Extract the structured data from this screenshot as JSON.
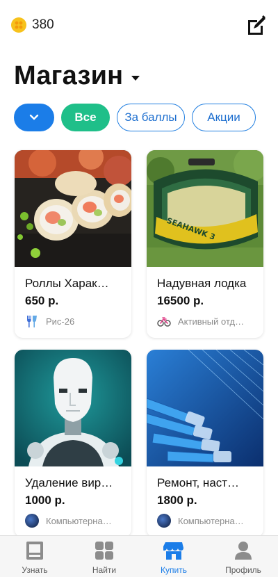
{
  "header": {
    "coins": "380",
    "coin_icon": "coin-icon",
    "edit_icon": "edit-icon"
  },
  "page": {
    "title": "Магазин",
    "title_caret_icon": "caret-down-icon"
  },
  "filters": {
    "filter_icon": "chevron-down-icon",
    "chips": [
      {
        "label": "Все",
        "active": true
      },
      {
        "label": "За баллы",
        "active": false
      },
      {
        "label": "Акции",
        "active": false
      }
    ]
  },
  "products": [
    {
      "title": "Роллы Харак…",
      "price": "650 р.",
      "vendor": "Рис-26",
      "vendor_icon": "restaurant-icon"
    },
    {
      "title": "Надувная лодка",
      "price": "16500 р.",
      "vendor": "Активный отд…",
      "vendor_icon": "bicycle-icon"
    },
    {
      "title": "Удаление вир…",
      "price": "1000 р.",
      "vendor": "Компьютерна…",
      "vendor_icon": "avatar"
    },
    {
      "title": "Ремонт, наст…",
      "price": "1800 р.",
      "vendor": "Компьютерна…",
      "vendor_icon": "avatar"
    }
  ],
  "tabbar": {
    "tabs": [
      {
        "label": "Узнать",
        "icon": "news-icon",
        "active": false
      },
      {
        "label": "Найти",
        "icon": "grid-icon",
        "active": false
      },
      {
        "label": "Купить",
        "icon": "store-icon",
        "active": true
      },
      {
        "label": "Профиль",
        "icon": "person-icon",
        "active": false
      }
    ]
  },
  "colors": {
    "primary": "#1b7de8",
    "accent_green": "#1fbf89",
    "coin": "#f7c21c"
  }
}
